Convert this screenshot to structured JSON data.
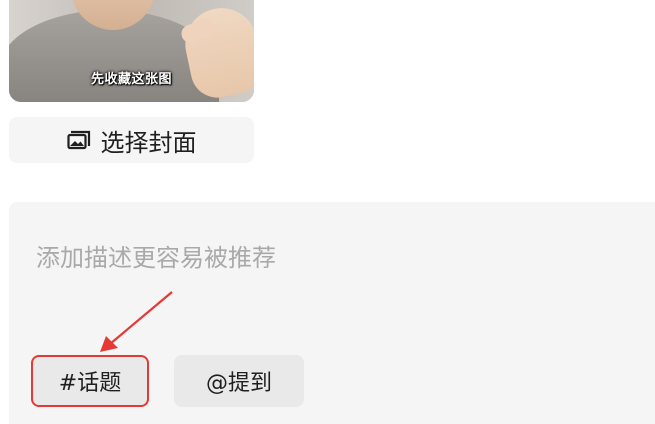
{
  "thumbnail": {
    "caption": "先收藏这张图"
  },
  "cover_button": {
    "icon": "image-icon",
    "label": "选择封面"
  },
  "description": {
    "placeholder": "添加描述更容易被推荐"
  },
  "chips": {
    "topic_label": "#话题",
    "mention_label": "@提到"
  },
  "colors": {
    "annotation_red": "#e53935",
    "panel_bg": "#f5f5f5",
    "chip_bg": "#e9e9e9"
  }
}
